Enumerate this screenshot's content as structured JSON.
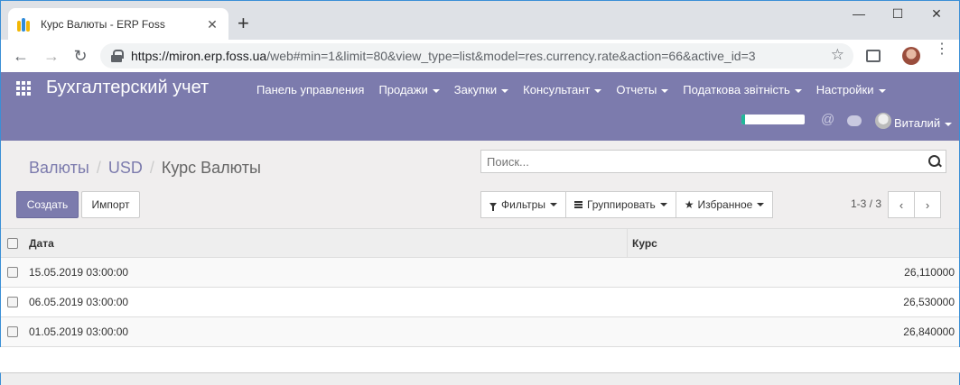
{
  "browser": {
    "tab_title": "Курс Валюты - ERP Foss",
    "tab_close": "✕",
    "new_tab": "+",
    "window": {
      "minimize": "—",
      "maximize": "☐",
      "close": "✕"
    },
    "back": "←",
    "forward": "→",
    "reload": "↻",
    "url_host": "https://miron.erp.foss.ua",
    "url_rest": "/web#min=1&limit=80&view_type=list&model=res.currency.rate&action=66&active_id=3",
    "star": "☆",
    "menu": "⋮"
  },
  "navbar": {
    "app_name": "Бухгалтерский учет",
    "menu": [
      {
        "label": "Панель управления",
        "dropdown": false
      },
      {
        "label": "Продажи",
        "dropdown": true
      },
      {
        "label": "Закупки",
        "dropdown": true
      },
      {
        "label": "Консультант",
        "dropdown": true
      },
      {
        "label": "Отчеты",
        "dropdown": true
      },
      {
        "label": "Податкова звітність",
        "dropdown": true
      },
      {
        "label": "Настройки",
        "dropdown": true
      }
    ],
    "progress": 0.06,
    "at_symbol": "@",
    "user_name": "Виталий"
  },
  "control_panel": {
    "breadcrumb": [
      "Валюты",
      "USD",
      "Курс Валюты"
    ],
    "search_placeholder": "Поиск...",
    "create_label": "Создать",
    "import_label": "Импорт",
    "filters_label": "Фильтры",
    "group_label": "Группировать",
    "favorites_label": "Избранное",
    "favorites_icon": "★",
    "pager_text": "1-3 / 3",
    "prev": "‹",
    "next": "›"
  },
  "table": {
    "headers": [
      "Дата",
      "Курс"
    ],
    "rows": [
      {
        "date": "15.05.2019 03:00:00",
        "rate": "26,110000"
      },
      {
        "date": "06.05.2019 03:00:00",
        "rate": "26,530000"
      },
      {
        "date": "01.05.2019 03:00:00",
        "rate": "26,840000"
      }
    ]
  }
}
